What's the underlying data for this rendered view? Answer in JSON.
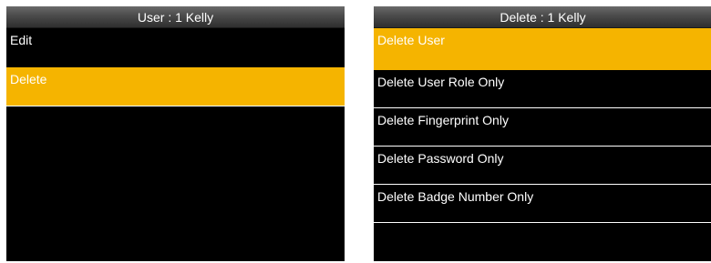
{
  "left_screen": {
    "title": "User : 1 Kelly",
    "items": [
      {
        "label": "Edit",
        "selected": false
      },
      {
        "label": "Delete",
        "selected": true
      }
    ]
  },
  "right_screen": {
    "title": "Delete : 1 Kelly",
    "items": [
      {
        "label": "Delete User",
        "selected": true
      },
      {
        "label": "Delete User Role Only",
        "selected": false
      },
      {
        "label": "Delete Fingerprint Only",
        "selected": false
      },
      {
        "label": "Delete Password Only",
        "selected": false
      },
      {
        "label": "Delete Badge Number Only",
        "selected": false
      }
    ]
  },
  "colors": {
    "highlight": "#f5b400",
    "background": "#000000",
    "text": "#ffffff"
  }
}
